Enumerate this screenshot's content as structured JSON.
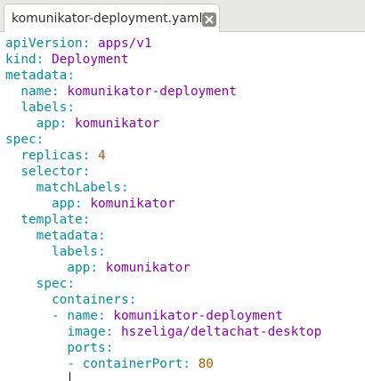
{
  "tab": {
    "title": "komunikator-deployment.yaml",
    "close_icon": "close-x-icon"
  },
  "colors": {
    "key": "#00909c",
    "string": "#8a00b0",
    "number": "#a85a00",
    "tab_bar": "#e8e8e7"
  },
  "lines": [
    {
      "indent": "",
      "key": "apiVersion",
      "value": "apps/v1",
      "type": "str"
    },
    {
      "indent": "",
      "key": "kind",
      "value": "Deployment",
      "type": "str"
    },
    {
      "indent": "",
      "key": "metadata",
      "value": "",
      "type": "none"
    },
    {
      "indent": "  ",
      "key": "name",
      "value": "komunikator-deployment",
      "type": "str"
    },
    {
      "indent": "  ",
      "key": "labels",
      "value": "",
      "type": "none"
    },
    {
      "indent": "    ",
      "key": "app",
      "value": "komunikator",
      "type": "str"
    },
    {
      "indent": "",
      "key": "spec",
      "value": "",
      "type": "none"
    },
    {
      "indent": "  ",
      "key": "replicas",
      "value": "4",
      "type": "num"
    },
    {
      "indent": "  ",
      "key": "selector",
      "value": "",
      "type": "none"
    },
    {
      "indent": "    ",
      "key": "matchLabels",
      "value": "",
      "type": "none"
    },
    {
      "indent": "      ",
      "key": "app",
      "value": "komunikator",
      "type": "str"
    },
    {
      "indent": "  ",
      "key": "template",
      "value": "",
      "type": "none"
    },
    {
      "indent": "    ",
      "key": "metadata",
      "value": "",
      "type": "none"
    },
    {
      "indent": "      ",
      "key": "labels",
      "value": "",
      "type": "none"
    },
    {
      "indent": "        ",
      "key": "app",
      "value": "komunikator",
      "type": "str"
    },
    {
      "indent": "    ",
      "key": "spec",
      "value": "",
      "type": "none"
    },
    {
      "indent": "      ",
      "key": "containers",
      "value": "",
      "type": "none"
    },
    {
      "indent": "      ",
      "dash": "- ",
      "key": "name",
      "value": "komunikator-deployment",
      "type": "str"
    },
    {
      "indent": "        ",
      "key": "image",
      "value": "hszeliga/deltachat-desktop",
      "type": "str"
    },
    {
      "indent": "        ",
      "key": "ports",
      "value": "",
      "type": "none"
    },
    {
      "indent": "        ",
      "dash": "- ",
      "key": "containerPort",
      "value": "80",
      "type": "num"
    }
  ]
}
